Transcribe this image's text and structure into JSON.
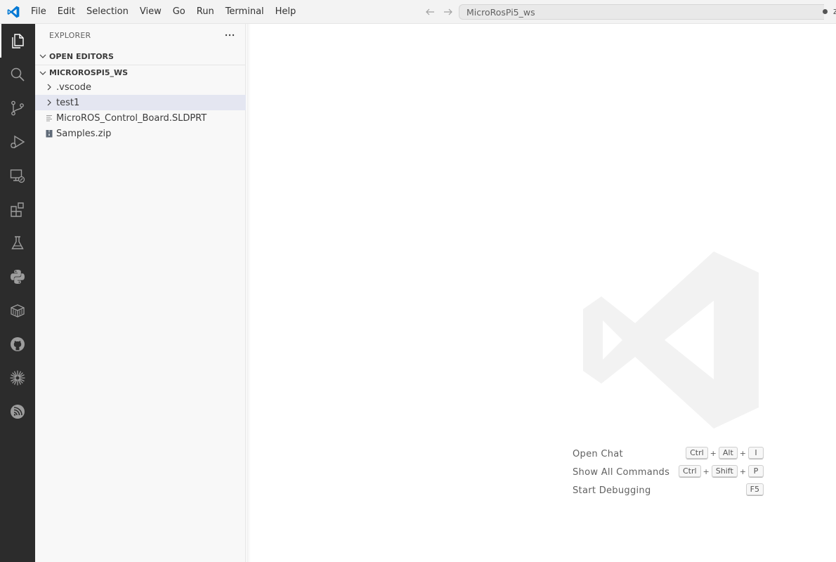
{
  "menu": {
    "items": [
      "File",
      "Edit",
      "Selection",
      "View",
      "Go",
      "Run",
      "Terminal",
      "Help"
    ]
  },
  "title_bar": {
    "search_text": "MicroRosPi5_ws",
    "clipped_text": "z"
  },
  "activity_bar": {
    "icons": [
      "explorer-icon",
      "search-icon",
      "source-control-icon",
      "run-debug-icon",
      "remote-explorer-icon",
      "extensions-icon",
      "testing-icon",
      "python-icon",
      "container-icon",
      "github-icon",
      "sparkle-icon",
      "esp-idf-icon"
    ]
  },
  "sidebar": {
    "title": "EXPLORER",
    "open_editors": "OPEN EDITORS",
    "workspace": "MICROROSPI5_WS",
    "tree": [
      {
        "label": ".vscode",
        "kind": "folder"
      },
      {
        "label": "test1",
        "kind": "folder",
        "selected": true
      },
      {
        "label": "MicroROS_Control_Board.SLDPRT",
        "kind": "file"
      },
      {
        "label": "Samples.zip",
        "kind": "zip"
      }
    ]
  },
  "editor": {
    "shortcuts": [
      {
        "label": "Open Chat",
        "keys": [
          "Ctrl",
          "Alt",
          "I"
        ]
      },
      {
        "label": "Show All Commands",
        "keys": [
          "Ctrl",
          "Shift",
          "P"
        ]
      },
      {
        "label": "Start Debugging",
        "keys": [
          "F5"
        ]
      }
    ]
  },
  "colors": {
    "activity_bar": "#2c2c2c",
    "sidebar": "#f8f8f8",
    "selection": "#e4e6f1",
    "accent": "#0078d4"
  }
}
